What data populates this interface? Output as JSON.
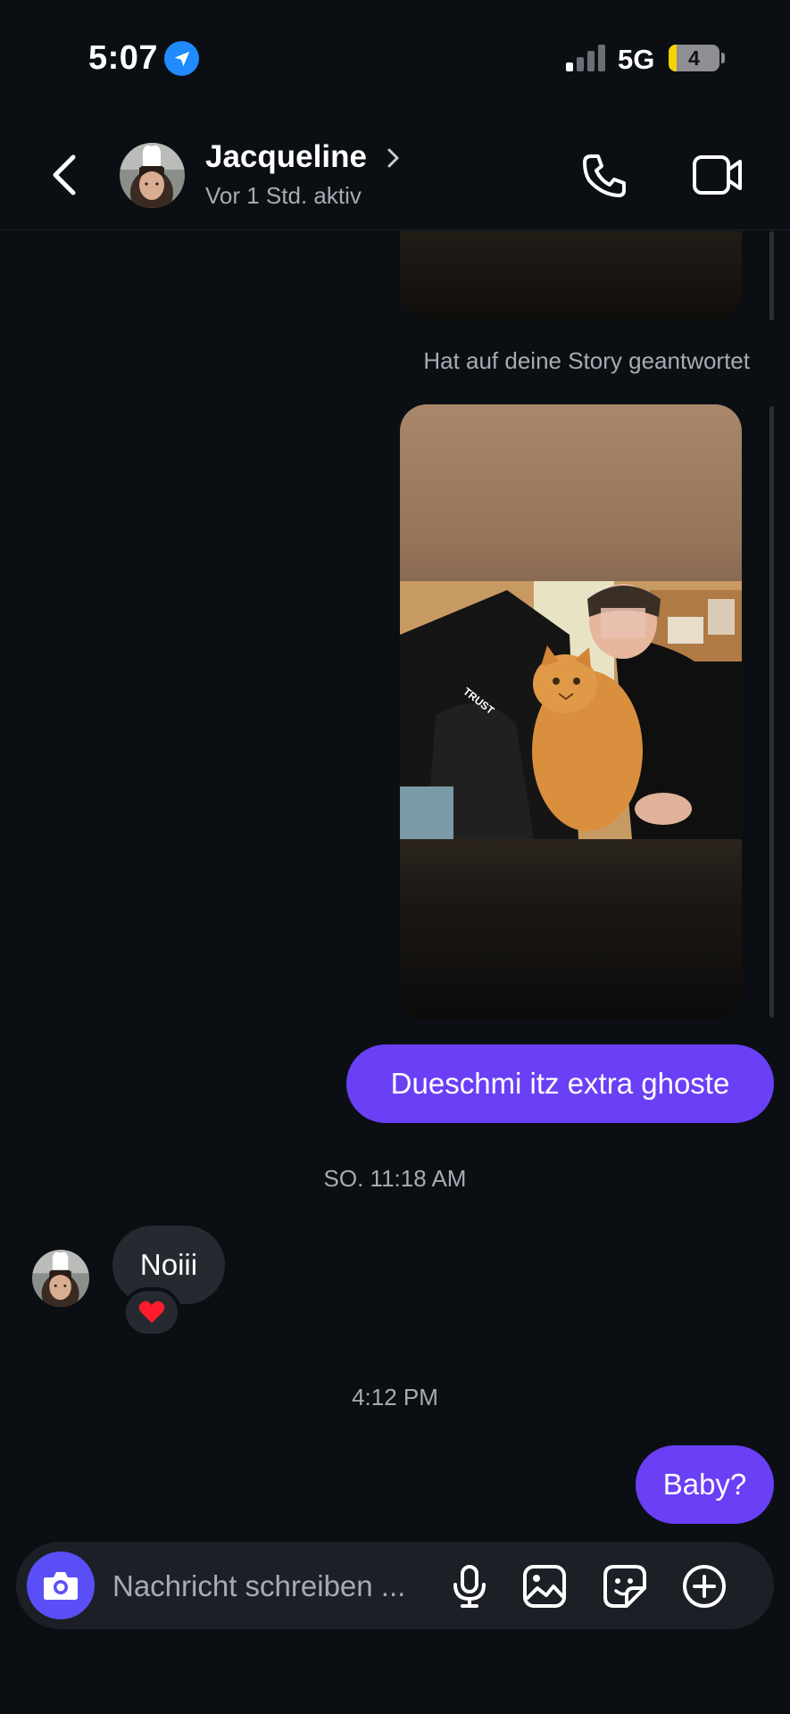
{
  "status_bar": {
    "time": "5:07",
    "network": "5G",
    "battery": "4",
    "battery_level_percent": 4,
    "location_icon": "location-arrow-icon"
  },
  "header": {
    "contact_name": "Jacqueline",
    "activity_status": "Vor 1 Std. aktiv",
    "icons": [
      "back-chevron-icon",
      "phone-icon",
      "video-camera-icon"
    ]
  },
  "chat": {
    "story_reply_note": "Hat auf deine Story geantwortet",
    "story_text": "TRUST",
    "messages": [
      {
        "direction": "out",
        "text": "Dueschmi itz extra ghoste"
      },
      {
        "timestamp": "SO. 11:18 AM"
      },
      {
        "direction": "in",
        "text": "Noiii",
        "reaction": "❤️"
      },
      {
        "timestamp": "4:12 PM"
      },
      {
        "direction": "out",
        "text": "Baby?"
      }
    ]
  },
  "composer": {
    "placeholder": "Nachricht schreiben ...",
    "value": "",
    "icons": [
      "camera-icon",
      "microphone-icon",
      "gallery-icon",
      "sticker-icon",
      "plus-icon"
    ]
  },
  "colors": {
    "background": "#0b0f14",
    "outgoing_bubble": "#6a3ff5",
    "incoming_bubble": "#262a30",
    "camera_button": "#5a4ff7",
    "secondary_text": "#a7abb2",
    "location_blue": "#1f8bff"
  }
}
